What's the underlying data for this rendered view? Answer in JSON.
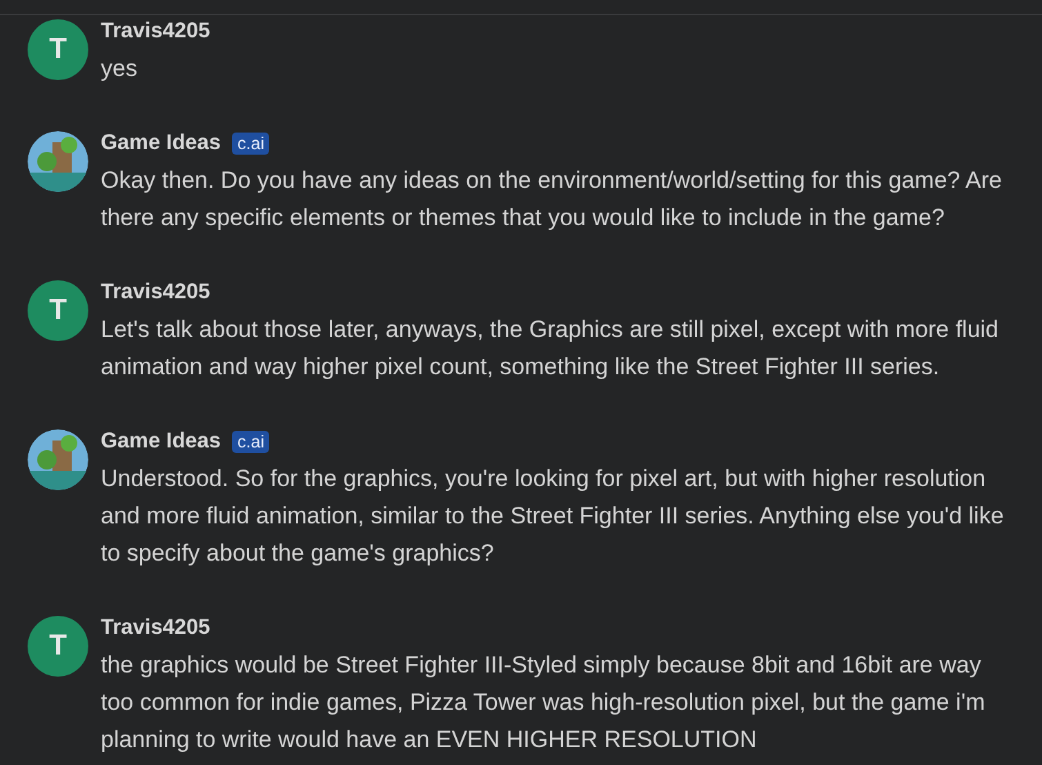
{
  "messages": [
    {
      "author": "Travis4205",
      "avatar": {
        "kind": "letter",
        "letter": "T"
      },
      "text": "yes"
    },
    {
      "author": "Game Ideas",
      "badge": "c.ai",
      "avatar": {
        "kind": "picture"
      },
      "text": "Okay then. Do you have any ideas on the environment/world/setting for this game? Are there any specific elements or themes that you would like to include in the game?"
    },
    {
      "author": "Travis4205",
      "avatar": {
        "kind": "letter",
        "letter": "T"
      },
      "text": "Let's talk about those later, anyways, the Graphics are still pixel, except with more fluid animation and way higher pixel count, something like the Street Fighter III series."
    },
    {
      "author": "Game Ideas",
      "badge": "c.ai",
      "avatar": {
        "kind": "picture"
      },
      "text": "Understood. So for the graphics, you're looking for pixel art, but with higher resolution and more fluid animation, similar to the Street Fighter III series. Anything else you'd like to specify about the game's graphics?"
    },
    {
      "author": "Travis4205",
      "avatar": {
        "kind": "letter",
        "letter": "T"
      },
      "text": "the graphics would be Street Fighter III-Styled simply because 8bit and 16bit are way too common for indie games, Pizza Tower was high-resolution pixel, but the game i'm planning to write would have an EVEN HIGHER RESOLUTION"
    }
  ]
}
